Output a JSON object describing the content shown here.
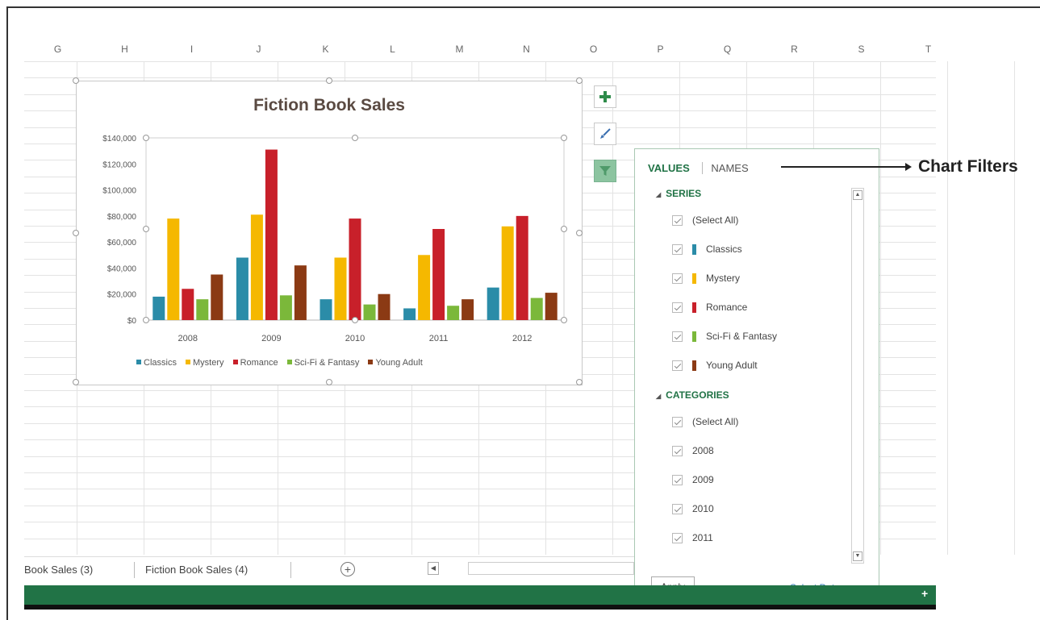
{
  "columns": [
    "G",
    "H",
    "I",
    "J",
    "K",
    "L",
    "M",
    "N",
    "O",
    "P",
    "Q",
    "R",
    "S",
    "T"
  ],
  "chart": {
    "title": "Fiction Book Sales",
    "y_ticks": [
      "$140,000",
      "$120,000",
      "$100,000",
      "$80,000",
      "$60,000",
      "$40,000",
      "$20,000",
      "$0"
    ],
    "categories": [
      "2008",
      "2009",
      "2010",
      "2011",
      "2012"
    ]
  },
  "chart_data": {
    "type": "bar",
    "title": "Fiction Book Sales",
    "categories": [
      "2008",
      "2009",
      "2010",
      "2011",
      "2012"
    ],
    "ylim": [
      0,
      140000
    ],
    "series": [
      {
        "name": "Classics",
        "color": "#2b8ca8",
        "values": [
          18000,
          48000,
          16000,
          9000,
          25000
        ]
      },
      {
        "name": "Mystery",
        "color": "#f5b800",
        "values": [
          78000,
          81000,
          48000,
          50000,
          72000
        ]
      },
      {
        "name": "Romance",
        "color": "#c8202a",
        "values": [
          24000,
          131000,
          78000,
          70000,
          80000
        ]
      },
      {
        "name": "Sci-Fi & Fantasy",
        "color": "#7bb83a",
        "values": [
          16000,
          19000,
          12000,
          11000,
          17000
        ]
      },
      {
        "name": "Young Adult",
        "color": "#8b3a14",
        "values": [
          35000,
          42000,
          20000,
          16000,
          21000
        ]
      }
    ],
    "legend": "bottom",
    "grid": false
  },
  "side_buttons": [
    {
      "icon": "plus-icon"
    },
    {
      "icon": "brush-icon"
    },
    {
      "icon": "filter-icon"
    }
  ],
  "filter_panel": {
    "tabs": {
      "values": "VALUES",
      "names": "NAMES"
    },
    "series_heading": "SERIES",
    "series_items": [
      "(Select All)",
      "Classics",
      "Mystery",
      "Romance",
      "Sci-Fi & Fantasy",
      "Young Adult"
    ],
    "categories_heading": "CATEGORIES",
    "category_items": [
      "(Select All)",
      "2008",
      "2009",
      "2010",
      "2011"
    ],
    "apply_label": "Apply",
    "select_data_label": "Select Data..."
  },
  "annotation": "Chart Filters",
  "sheet_tabs": [
    "Book Sales (3)",
    "Fiction Book Sales (4)"
  ],
  "colors": {
    "excel_green": "#217346",
    "panel_border": "#a9c8b3",
    "accent_link": "#2e75b6"
  }
}
